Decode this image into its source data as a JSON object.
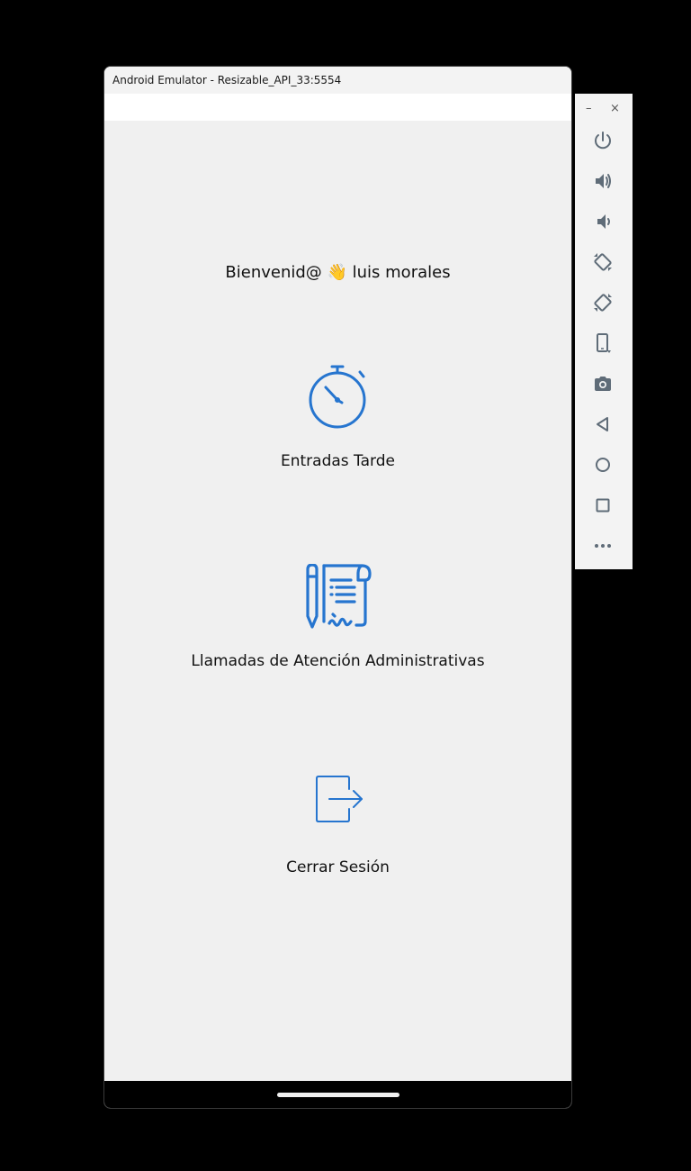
{
  "window": {
    "title": "Android Emulator - Resizable_API_33:5554"
  },
  "app": {
    "welcome_text": "Bienvenid@ 👋 luis morales",
    "menu": [
      {
        "label": "Entradas Tarde",
        "icon": "stopwatch-icon"
      },
      {
        "label": "Llamadas de Atención Administrativas",
        "icon": "document-signature-icon"
      },
      {
        "label": "Cerrar Sesión",
        "icon": "logout-icon"
      }
    ],
    "accent_color": "#2675cf"
  },
  "toolbar": {
    "minimize_label": "–",
    "close_label": "×",
    "buttons": [
      "power-icon",
      "volume-up-icon",
      "volume-down-icon",
      "rotate-left-icon",
      "rotate-right-icon",
      "fold-device-icon",
      "camera-icon",
      "back-icon",
      "home-icon",
      "overview-icon",
      "more-icon"
    ],
    "icon_color": "#5f6c78"
  }
}
